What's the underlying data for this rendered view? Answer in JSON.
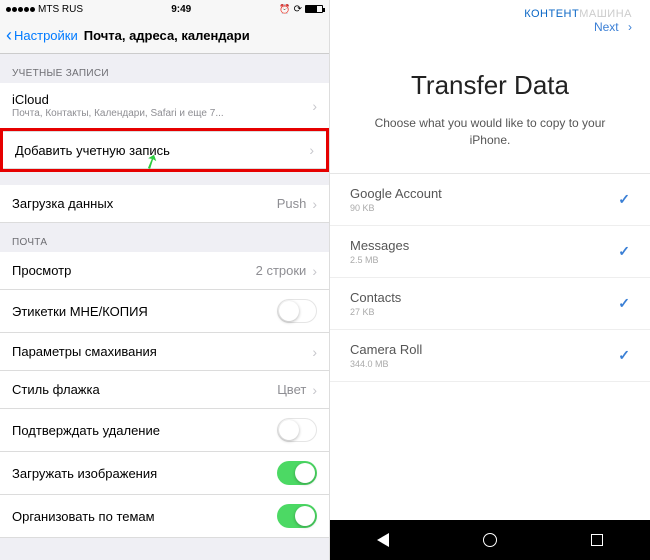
{
  "left": {
    "status": {
      "carrier": "MTS RUS",
      "time": "9:49"
    },
    "nav": {
      "back": "Настройки",
      "title": "Почта, адреса, календари"
    },
    "section_accounts": "УЧЕТНЫЕ ЗАПИСИ",
    "icloud": {
      "title": "iCloud",
      "sub": "Почта, Контакты, Календари, Safari и еще 7..."
    },
    "add_account": "Добавить учетную запись",
    "fetch": {
      "title": "Загрузка данных",
      "value": "Push"
    },
    "section_mail": "ПОЧТА",
    "preview": {
      "title": "Просмотр",
      "value": "2 строки"
    },
    "cc_labels": "Этикетки МНЕ/КОПИЯ",
    "swipe": "Параметры смахивания",
    "flag": {
      "title": "Стиль флажка",
      "value": "Цвет"
    },
    "confirm_delete": "Подтверждать удаление",
    "load_images": "Загружать изображения",
    "organize": "Организовать по темам"
  },
  "right": {
    "watermark1": "КОНТЕНТ",
    "watermark2": "МАШИНА",
    "next": "Next",
    "title": "Transfer Data",
    "subtitle": "Choose what you would like to copy to your iPhone.",
    "items": [
      {
        "title": "Google Account",
        "sub": "90 KB"
      },
      {
        "title": "Messages",
        "sub": "2.5 MB"
      },
      {
        "title": "Contacts",
        "sub": "27 KB"
      },
      {
        "title": "Camera Roll",
        "sub": "344.0 MB"
      }
    ]
  }
}
